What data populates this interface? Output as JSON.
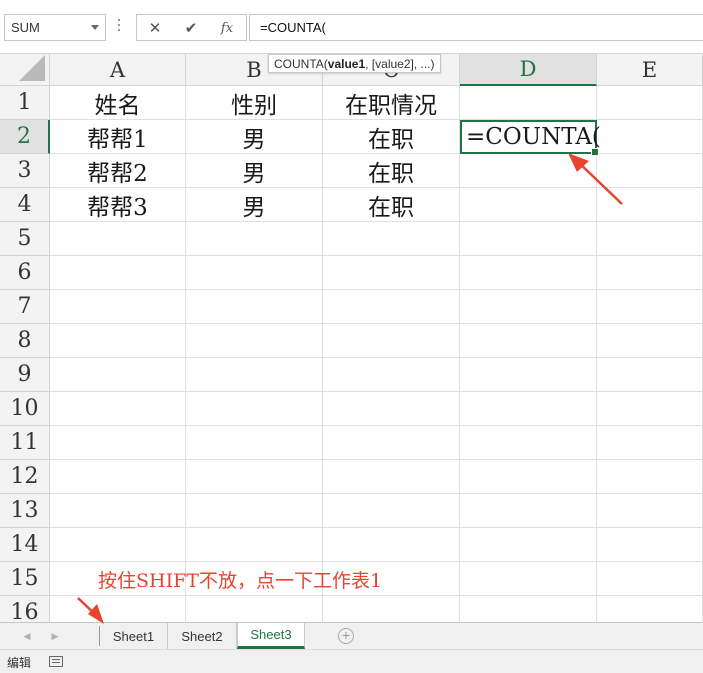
{
  "formula_bar": {
    "name_box": "SUM",
    "cancel_icon": "✕",
    "enter_icon": "✔",
    "fx_label": "fx",
    "formula": "=COUNTA("
  },
  "tooltip": {
    "func": "COUNTA(",
    "arg1": "value1",
    "rest": ", [value2], ...)"
  },
  "columns": [
    "A",
    "B",
    "C",
    "D",
    "E"
  ],
  "active_column": "D",
  "rows": [
    "1",
    "2",
    "3",
    "4",
    "5",
    "6",
    "7",
    "8",
    "9",
    "10",
    "11",
    "12",
    "13",
    "14",
    "15",
    "16"
  ],
  "active_row": "2",
  "cells": {
    "A1": "姓名",
    "B1": "性别",
    "C1": "在职情况",
    "A2": "帮帮1",
    "B2": "男",
    "C2": "在职",
    "D2": "=COUNTA(",
    "A3": "帮帮2",
    "B3": "男",
    "C3": "在职",
    "A4": "帮帮3",
    "B4": "男",
    "C4": "在职"
  },
  "annotation": {
    "text": "按住SHIFT不放，点一下工作表1",
    "color": "#e8432f"
  },
  "sheet_tabs": [
    {
      "label": "Sheet1",
      "active": false
    },
    {
      "label": "Sheet2",
      "active": false
    },
    {
      "label": "Sheet3",
      "active": true
    }
  ],
  "add_sheet_icon": "+",
  "status": {
    "mode": "编辑"
  },
  "colors": {
    "accent": "#217346",
    "annotation": "#e8432f"
  }
}
